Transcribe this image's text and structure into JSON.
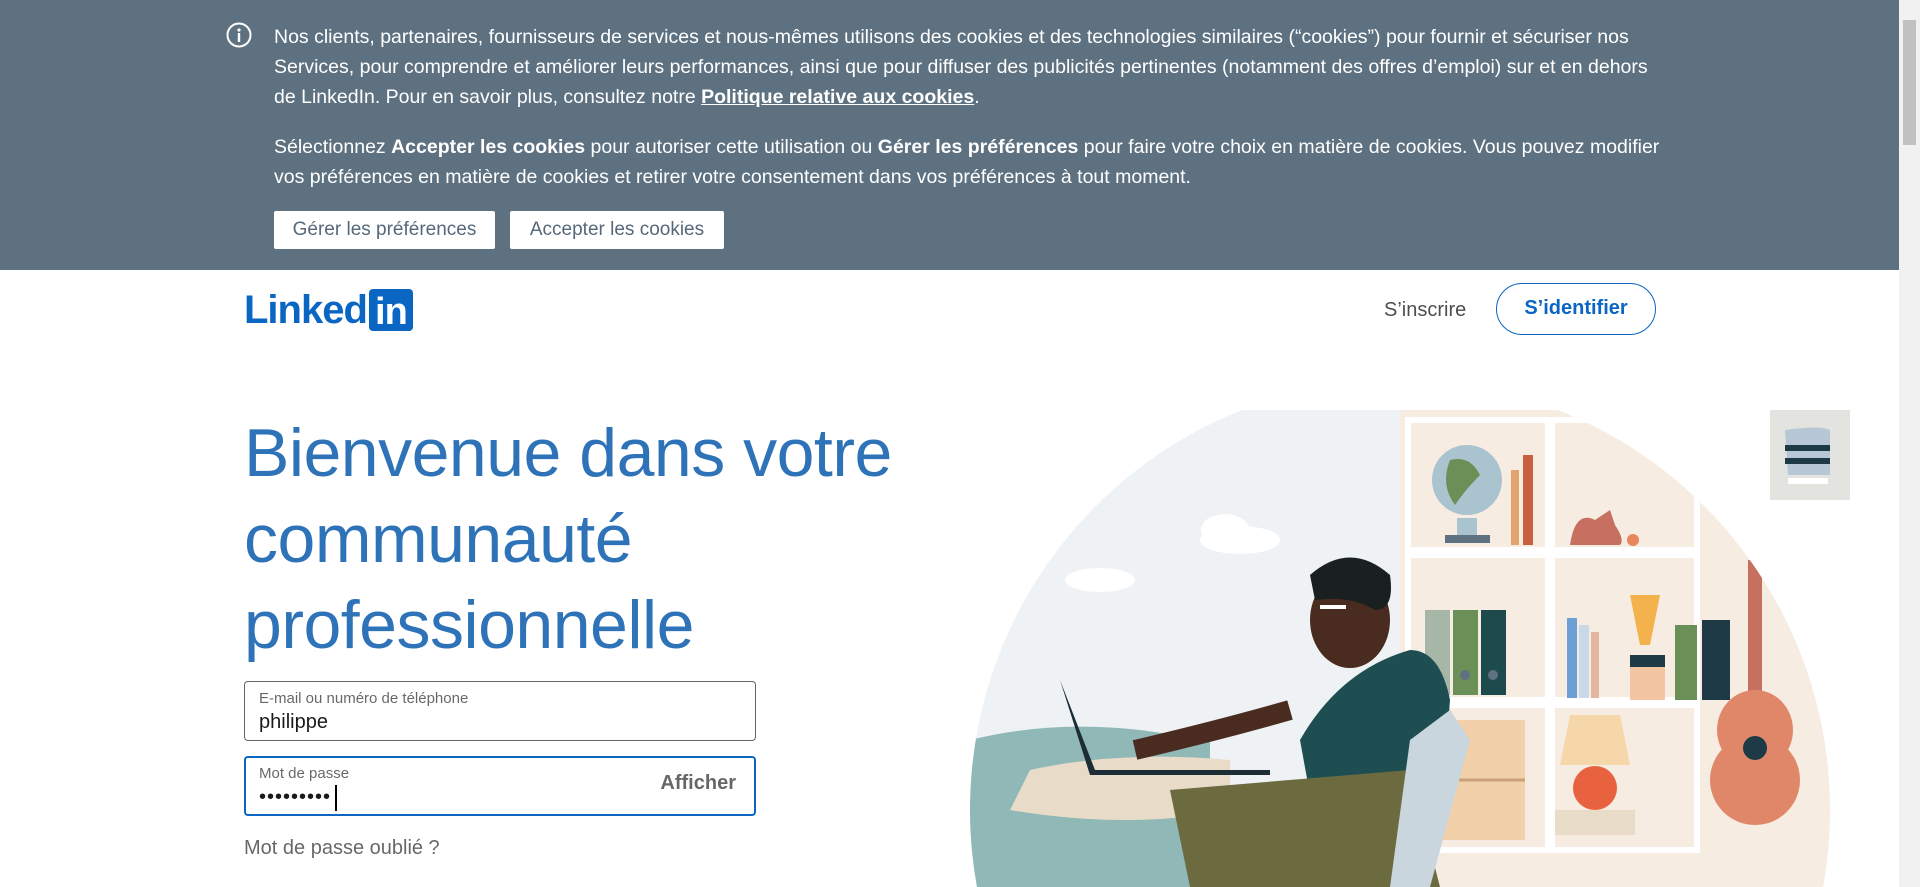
{
  "cookie_banner": {
    "paragraph1_text": "Nos clients, partenaires, fournisseurs de services et nous-mêmes utilisons des cookies et des technologies similaires (“cookies”) pour fournir et sécuriser nos Services, pour comprendre et améliorer leurs performances, ainsi que pour diffuser des publicités pertinentes (notamment des offres d’emploi) sur et en dehors de LinkedIn. Pour en savoir plus, consultez notre ",
    "policy_link": "Politique relative aux cookies",
    "paragraph1_end": ".",
    "p2_part1": "Sélectionnez ",
    "p2_bold1": "Accepter les cookies",
    "p2_part2": " pour autoriser cette utilisation ou ",
    "p2_bold2": "Gérer les préférences",
    "p2_part3": " pour faire votre choix en matière de cookies. Vous pouvez modifier vos préférences en matière de cookies et retirer votre consentement dans vos préférences à tout moment.",
    "manage_button": "Gérer les préférences",
    "accept_button": "Accepter les cookies"
  },
  "header": {
    "logo_text": "Linked",
    "logo_box_text": "in",
    "join_link": "S’inscrire",
    "signin_button": "S’identifier"
  },
  "hero": {
    "title": "Bienvenue dans votre communauté professionnelle"
  },
  "login_form": {
    "email_label": "E-mail ou numéro de téléphone",
    "email_value": "philippe",
    "password_label": "Mot de passe",
    "password_value": "•••••••••",
    "show_password": "Afficher",
    "forgot_password": "Mot de passe oublié ?"
  },
  "colors": {
    "brand": "#0a66c2",
    "banner_bg": "#5e7180",
    "hero_text": "#2e72b8"
  }
}
